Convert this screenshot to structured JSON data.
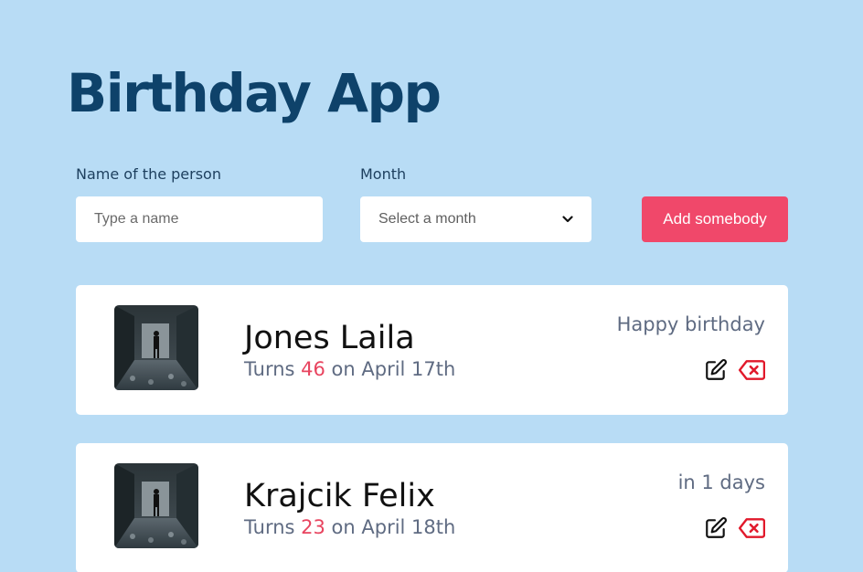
{
  "app": {
    "title": "Birthday App"
  },
  "form": {
    "name_label": "Name of the person",
    "name_placeholder": "Type a name",
    "month_label": "Month",
    "month_placeholder": "Select a month",
    "add_button_label": "Add somebody"
  },
  "people": [
    {
      "name": "Jones Laila",
      "turns_prefix": "Turns ",
      "age": "46",
      "date_text": " on April 17th",
      "status": "Happy birthday"
    },
    {
      "name": "Krajcik Felix",
      "turns_prefix": "Turns ",
      "age": "23",
      "date_text": " on April 18th",
      "status": "in 1 days"
    }
  ],
  "colors": {
    "background": "#b8dcf5",
    "title": "#0e426a",
    "accent": "#f0486a",
    "delete": "#e1192b"
  }
}
